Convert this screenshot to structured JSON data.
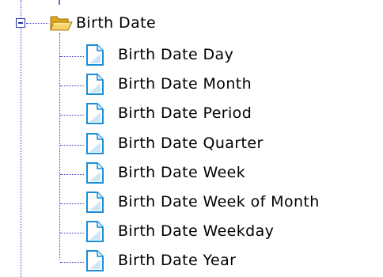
{
  "tree": {
    "folder": {
      "label": "Birth Date",
      "icon": "folder-open-icon",
      "expander": "collapse-minus-icon",
      "state": "expanded"
    },
    "items": [
      {
        "label": "Birth Date Day",
        "icon": "document-icon"
      },
      {
        "label": "Birth Date Month",
        "icon": "document-icon"
      },
      {
        "label": "Birth Date Period",
        "icon": "document-icon"
      },
      {
        "label": "Birth Date Quarter",
        "icon": "document-icon"
      },
      {
        "label": "Birth Date Week",
        "icon": "document-icon"
      },
      {
        "label": "Birth Date Week of Month",
        "icon": "document-icon"
      },
      {
        "label": "Birth Date Weekday",
        "icon": "document-icon"
      },
      {
        "label": "Birth Date Year",
        "icon": "document-icon"
      }
    ],
    "colors": {
      "connector": "#3a3acb",
      "folder": "#f2c648",
      "document_edge": "#1a8fd8"
    }
  }
}
